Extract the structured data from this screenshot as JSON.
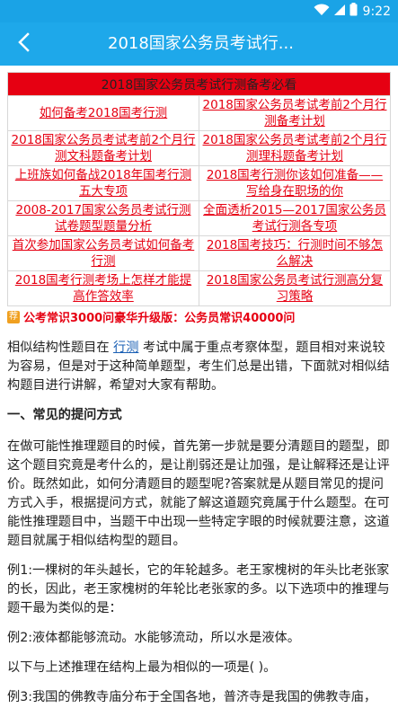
{
  "status_bar": {
    "time": "9:22",
    "icons": [
      "wifi-icon",
      "signal-icon",
      "battery-icon"
    ]
  },
  "app_bar": {
    "title": "2018国家公务员考试行...",
    "back_icon": "back-arrow-icon"
  },
  "link_table": {
    "header": "2018国家公务员考试行测备考必看",
    "rows": [
      [
        "如何备考2018国考行测",
        "2018国家公务员考试考前2个月行测备考计划"
      ],
      [
        "2018国家公务员考试考前2个月行测文科题备考计划",
        "2018国家公务员考试考前2个月行测理科题备考计划"
      ],
      [
        "上班族如何备战2018年国考行测五大专项",
        "2018国考行测你该如何准备——写给身在职场的你"
      ],
      [
        "2008-2017国家公务员考试行测试卷题型题量分析",
        "全面透析2015—2017国家公务员考试行测各专项"
      ],
      [
        "首次参加国家公务员考试如何备考行测",
        "2018国考技巧：行测时间不够怎么解决"
      ],
      [
        "2018国考行测考场上怎样才能提高作答效率",
        "2018国家公务员考试行测高分复习策略"
      ]
    ]
  },
  "promo": {
    "icon": "tag-icon",
    "icon_text": "荐",
    "text": "公考常识3000问豪华升级版：公务员常识40000问"
  },
  "article": {
    "intro_before": "相似结构性题目在",
    "intro_link": "行测",
    "intro_after": "考试中属于重点考察体型，题目相对来说较为容易，但是对于这种简单题型，考生们总是出错，下面就对相似结构题目进行讲解，希望对大家有帮助。",
    "section_heading": "一、常见的提问方式",
    "paragraph2": "在做可能性推理题目的时候，首先第一步就是要分清题目的题型，即这个题目究竟是考什么的，是让削弱还是让加强，是让解释还是让评价。既然如此，如何分清题目的题型呢?答案就是从题目常见的提问方式入手，根据提问方式，就能了解这道题究竟属于什么题型。在可能性推理题目中，当题干中出现一些特定字眼的时候就要注意，这道题目就属于相似结构型的题目。",
    "example1": "例1:一棵树的年头越长，它的年轮越多。老王家槐树的年头比老张家的长，因此，老王家槐树的年轮比老张家的多。以下选项中的推理与题干最为类似的是：",
    "example2": "例2:液体都能够流动。水能够流动，所以水是液体。",
    "question": "以下与上述推理在结构上最为相似的一项是( )。",
    "example3": "例3:我国的佛教寺庙分布于全国各地，普济寺是我国的佛教寺庙，"
  }
}
